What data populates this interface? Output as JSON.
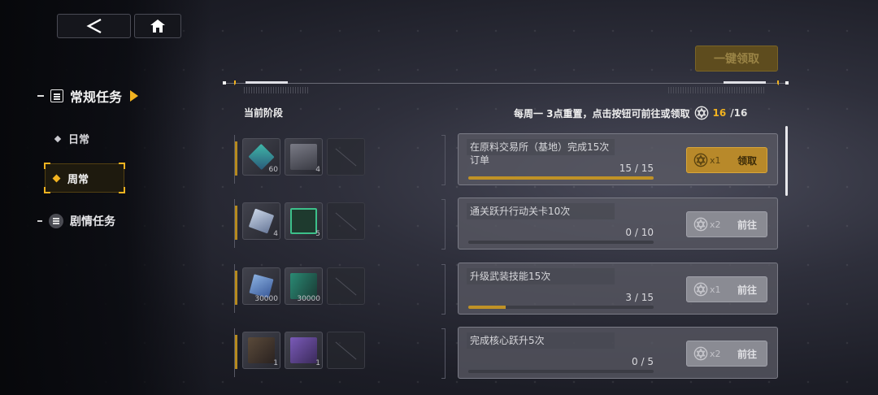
{
  "nav": {
    "back_icon": "back-chevron-icon",
    "home_icon": "home-icon"
  },
  "sidebar": {
    "main_category": "常规任务",
    "sub_items": [
      {
        "label": "日常",
        "active": false
      },
      {
        "label": "周常",
        "active": true
      }
    ],
    "story": "剧情任务"
  },
  "claim_all_label": "一键领取",
  "header": {
    "stage_label": "当前阶段",
    "reset_note": "每周一 3点重置，点击按钮可前往或领取",
    "count_current": "16",
    "count_total": "/16"
  },
  "tasks": [
    {
      "name": "在原料交易所（基地）完成15次订单",
      "progress_text": "15 / 15",
      "progress": 1.0,
      "reward_multiplier": "x1",
      "action": "领取",
      "action_type": "claim",
      "rewards": [
        {
          "qty": "60",
          "icon": "cube-chip-icon"
        },
        {
          "qty": "4",
          "icon": "data-card-icon"
        }
      ]
    },
    {
      "name": "通关跃升行动关卡10次",
      "progress_text": "0 / 10",
      "progress": 0.0,
      "reward_multiplier": "x2",
      "action": "前往",
      "action_type": "go",
      "rewards": [
        {
          "qty": "4",
          "icon": "crystal-cube-icon"
        },
        {
          "qty": "5",
          "icon": "ticket-02-icon"
        }
      ]
    },
    {
      "name": "升级武装技能15次",
      "progress_text": "3 / 15",
      "progress": 0.2,
      "reward_multiplier": "x1",
      "action": "前往",
      "action_type": "go",
      "rewards": [
        {
          "qty": "30000",
          "icon": "credit-block-icon"
        },
        {
          "qty": "30000",
          "icon": "exp-card-icon"
        }
      ]
    },
    {
      "name": "完成核心跃升5次",
      "progress_text": "0 / 5",
      "progress": 0.0,
      "reward_multiplier": "x2",
      "action": "前往",
      "action_type": "go",
      "rewards": [
        {
          "qty": "1",
          "icon": "device-box-icon"
        },
        {
          "qty": "1",
          "icon": "purple-crate-icon"
        }
      ]
    }
  ],
  "colors": {
    "accent": "#f2b320",
    "progress_fill": "#c09226"
  }
}
